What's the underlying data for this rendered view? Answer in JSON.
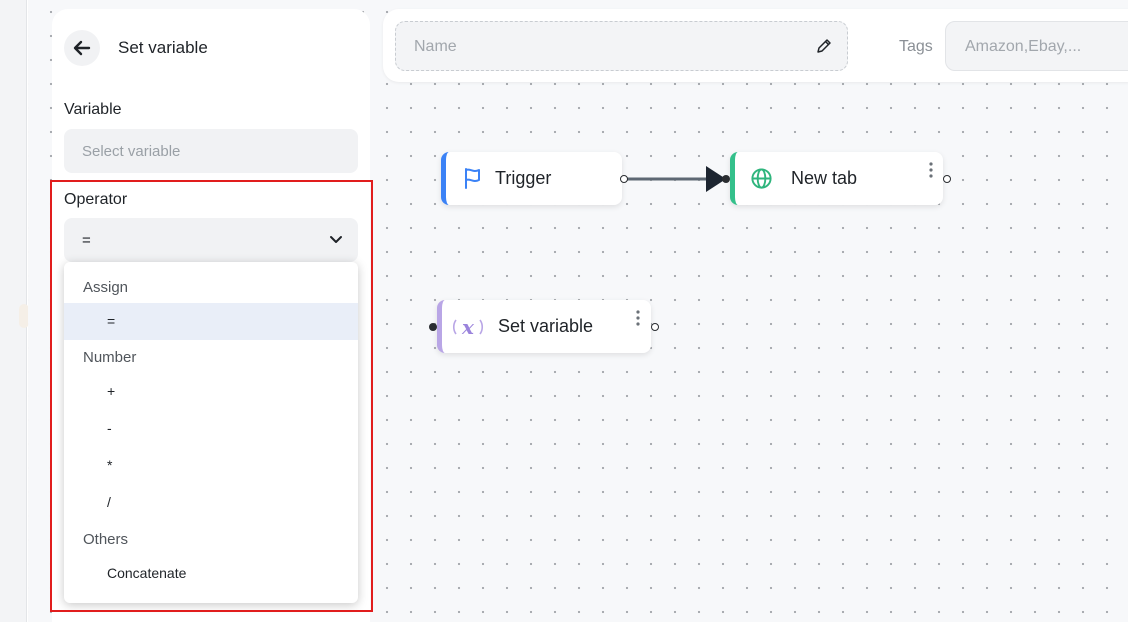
{
  "sidebar": {
    "title": "Set variable",
    "variable_label": "Variable",
    "variable_placeholder": "Select variable",
    "operator_label": "Operator",
    "operator_value": "=",
    "dropdown": {
      "groups": [
        {
          "label": "Assign",
          "items": [
            "="
          ]
        },
        {
          "label": "Number",
          "items": [
            "+",
            "-",
            "*",
            "/"
          ]
        },
        {
          "label": "Others",
          "items": [
            "Concatenate"
          ]
        }
      ],
      "selected": "="
    }
  },
  "topbar": {
    "name_placeholder": "Name",
    "tags_label": "Tags",
    "tags_placeholder": "Amazon,Ebay,..."
  },
  "canvas": {
    "nodes": [
      {
        "label": "Trigger",
        "icon": "flag-icon",
        "accent": "#3b82f6"
      },
      {
        "label": "New tab",
        "icon": "globe-icon",
        "accent": "#34c08b"
      },
      {
        "label": "Set variable",
        "icon": "variable-icon",
        "accent": "#b9a6e6"
      }
    ]
  },
  "colors": {
    "highlight": "#e11d1d",
    "selected_row": "#e9eef8"
  }
}
